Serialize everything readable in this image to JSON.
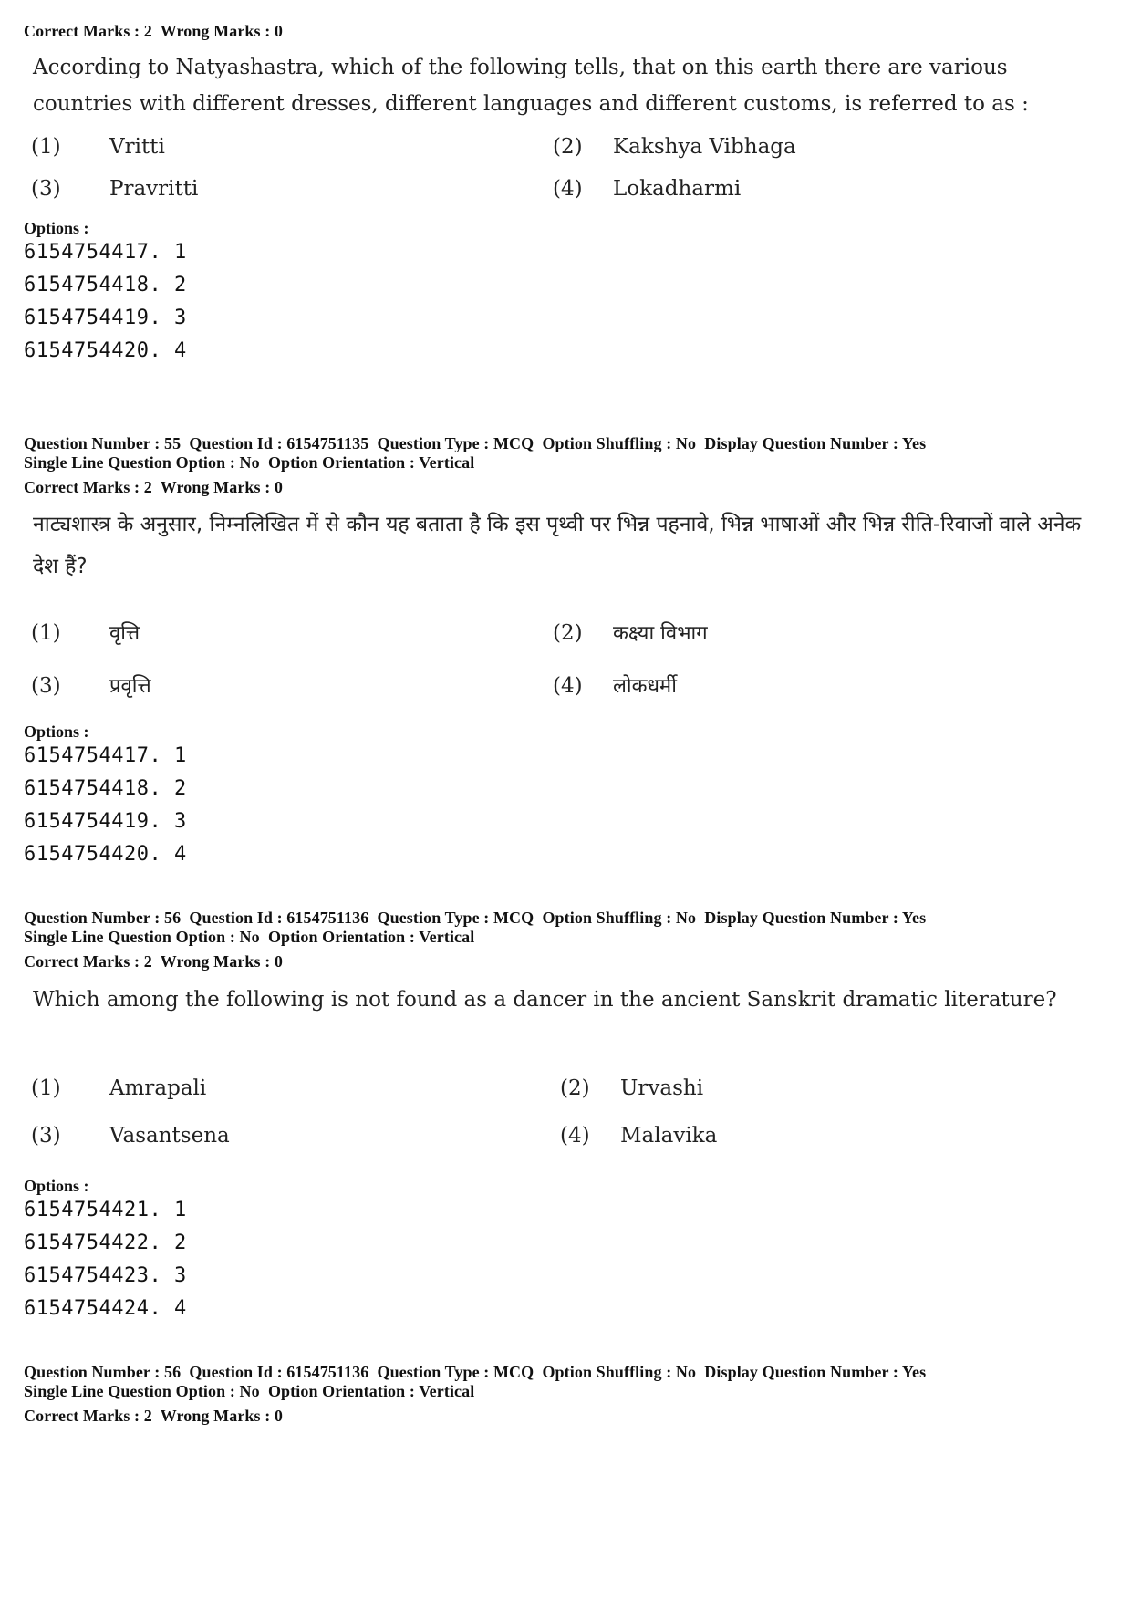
{
  "blocks": [
    {
      "marks": "Correct Marks : 2  Wrong Marks : 0",
      "question": "According to Natyashastra, which of the following tells, that on this earth there are various countries with different dresses, different languages and different customs, is referred to as :",
      "answers": [
        {
          "num": "(1)",
          "text": "Vritti"
        },
        {
          "num": "(2)",
          "text": "Kakshya Vibhaga"
        },
        {
          "num": "(3)",
          "text": "Pravritti"
        },
        {
          "num": "(4)",
          "text": "Lokadharmi"
        }
      ],
      "options_label": "Options :",
      "choices": [
        "6154754417. 1",
        "6154754418. 2",
        "6154754419. 3",
        "6154754420. 4"
      ]
    },
    {
      "header_line1": "Question Number : 55  Question Id : 6154751135  Question Type : MCQ  Option Shuffling : No  Display Question Number : Yes",
      "header_line2": "Single Line Question Option : No  Option Orientation : Vertical",
      "marks": "Correct Marks : 2  Wrong Marks : 0",
      "question": "नाट्यशास्त्र के अनुसार, निम्नलिखित में से कौन यह बताता है कि इस पृथ्वी पर भिन्न पहनावे, भिन्न भाषाओं और भिन्न रीति-रिवाजों वाले अनेक देश हैं?",
      "answers": [
        {
          "num": "(1)",
          "text": "वृत्ति"
        },
        {
          "num": "(2)",
          "text": "कक्ष्या विभाग"
        },
        {
          "num": "(3)",
          "text": "प्रवृत्ति"
        },
        {
          "num": "(4)",
          "text": "लोकधर्मी"
        }
      ],
      "options_label": "Options :",
      "choices": [
        "6154754417. 1",
        "6154754418. 2",
        "6154754419. 3",
        "6154754420. 4"
      ]
    },
    {
      "header_line1": "Question Number : 56  Question Id : 6154751136  Question Type : MCQ  Option Shuffling : No  Display Question Number : Yes",
      "header_line2": "Single Line Question Option : No  Option Orientation : Vertical",
      "marks": "Correct Marks : 2  Wrong Marks : 0",
      "question": "Which among the following is not found as a dancer in the ancient Sanskrit dramatic literature?",
      "answers": [
        {
          "num": "(1)",
          "text": "Amrapali"
        },
        {
          "num": "(2)",
          "text": "Urvashi"
        },
        {
          "num": "(3)",
          "text": "Vasantsena"
        },
        {
          "num": "(4)",
          "text": "Malavika"
        }
      ],
      "options_label": "Options :",
      "choices": [
        "6154754421. 1",
        "6154754422. 2",
        "6154754423. 3",
        "6154754424. 4"
      ]
    },
    {
      "header_line1": "Question Number : 56  Question Id : 6154751136  Question Type : MCQ  Option Shuffling : No  Display Question Number : Yes",
      "header_line2": "Single Line Question Option : No  Option Orientation : Vertical",
      "marks": "Correct Marks : 2  Wrong Marks : 0"
    }
  ]
}
